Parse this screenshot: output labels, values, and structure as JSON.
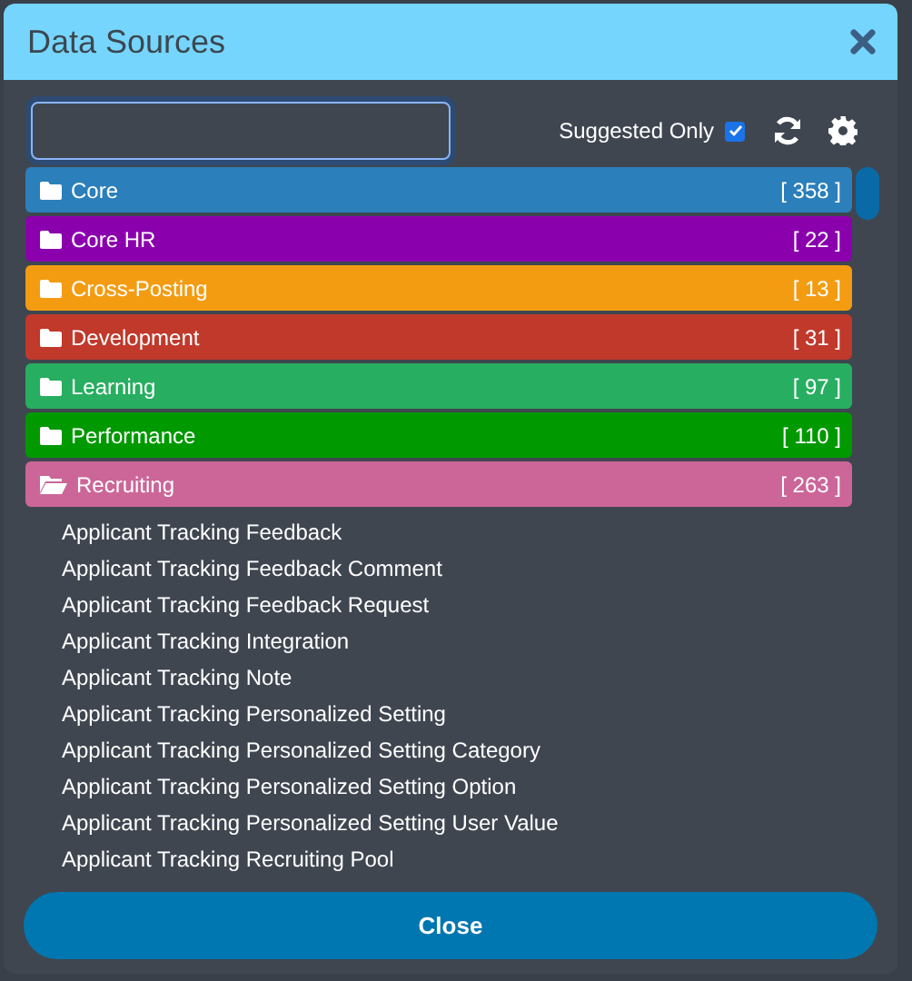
{
  "dialog": {
    "title": "Data Sources"
  },
  "suggested_only": {
    "label": "Suggested Only",
    "checked": true
  },
  "categories": [
    {
      "name": "Core",
      "count": "[ 358 ]",
      "color": "#2b7fba",
      "expanded": false
    },
    {
      "name": "Core HR",
      "count": "[ 22 ]",
      "color": "#8b00ad",
      "expanded": false
    },
    {
      "name": "Cross-Posting",
      "count": "[ 13 ]",
      "color": "#f39c12",
      "expanded": false
    },
    {
      "name": "Development",
      "count": "[ 31 ]",
      "color": "#c0392b",
      "expanded": false
    },
    {
      "name": "Learning",
      "count": "[ 97 ]",
      "color": "#27ae60",
      "expanded": false
    },
    {
      "name": "Performance",
      "count": "[ 110 ]",
      "color": "#009900",
      "expanded": false
    },
    {
      "name": "Recruiting",
      "count": "[ 263 ]",
      "color": "#cc6699",
      "expanded": true,
      "children": [
        "Applicant Tracking Feedback",
        "Applicant Tracking Feedback Comment",
        "Applicant Tracking Feedback Request",
        "Applicant Tracking Integration",
        "Applicant Tracking Note",
        "Applicant Tracking Personalized Setting",
        "Applicant Tracking Personalized Setting Category",
        "Applicant Tracking Personalized Setting Option",
        "Applicant Tracking Personalized Setting User Value",
        "Applicant Tracking Recruiting Pool"
      ]
    }
  ],
  "close_button": {
    "label": "Close"
  }
}
